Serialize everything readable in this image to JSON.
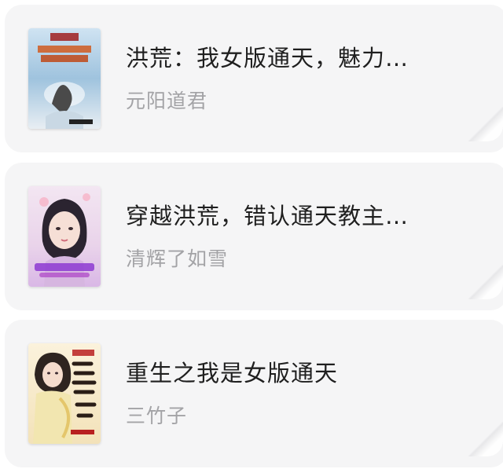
{
  "books": [
    {
      "title": "洪荒：我女版通天，魅力…",
      "author": "元阳道君",
      "cover_icon": "book-cover-sky-dragon"
    },
    {
      "title": "穿越洪荒，错认通天教主…",
      "author": "清辉了如雪",
      "cover_icon": "book-cover-portrait-girl"
    },
    {
      "title": "重生之我是女版通天",
      "author": "三竹子",
      "cover_icon": "book-cover-portrait-woman"
    }
  ],
  "colors": {
    "card_bg": "#f5f5f6",
    "title": "#1f1f1f",
    "author": "#a3a3a6"
  }
}
